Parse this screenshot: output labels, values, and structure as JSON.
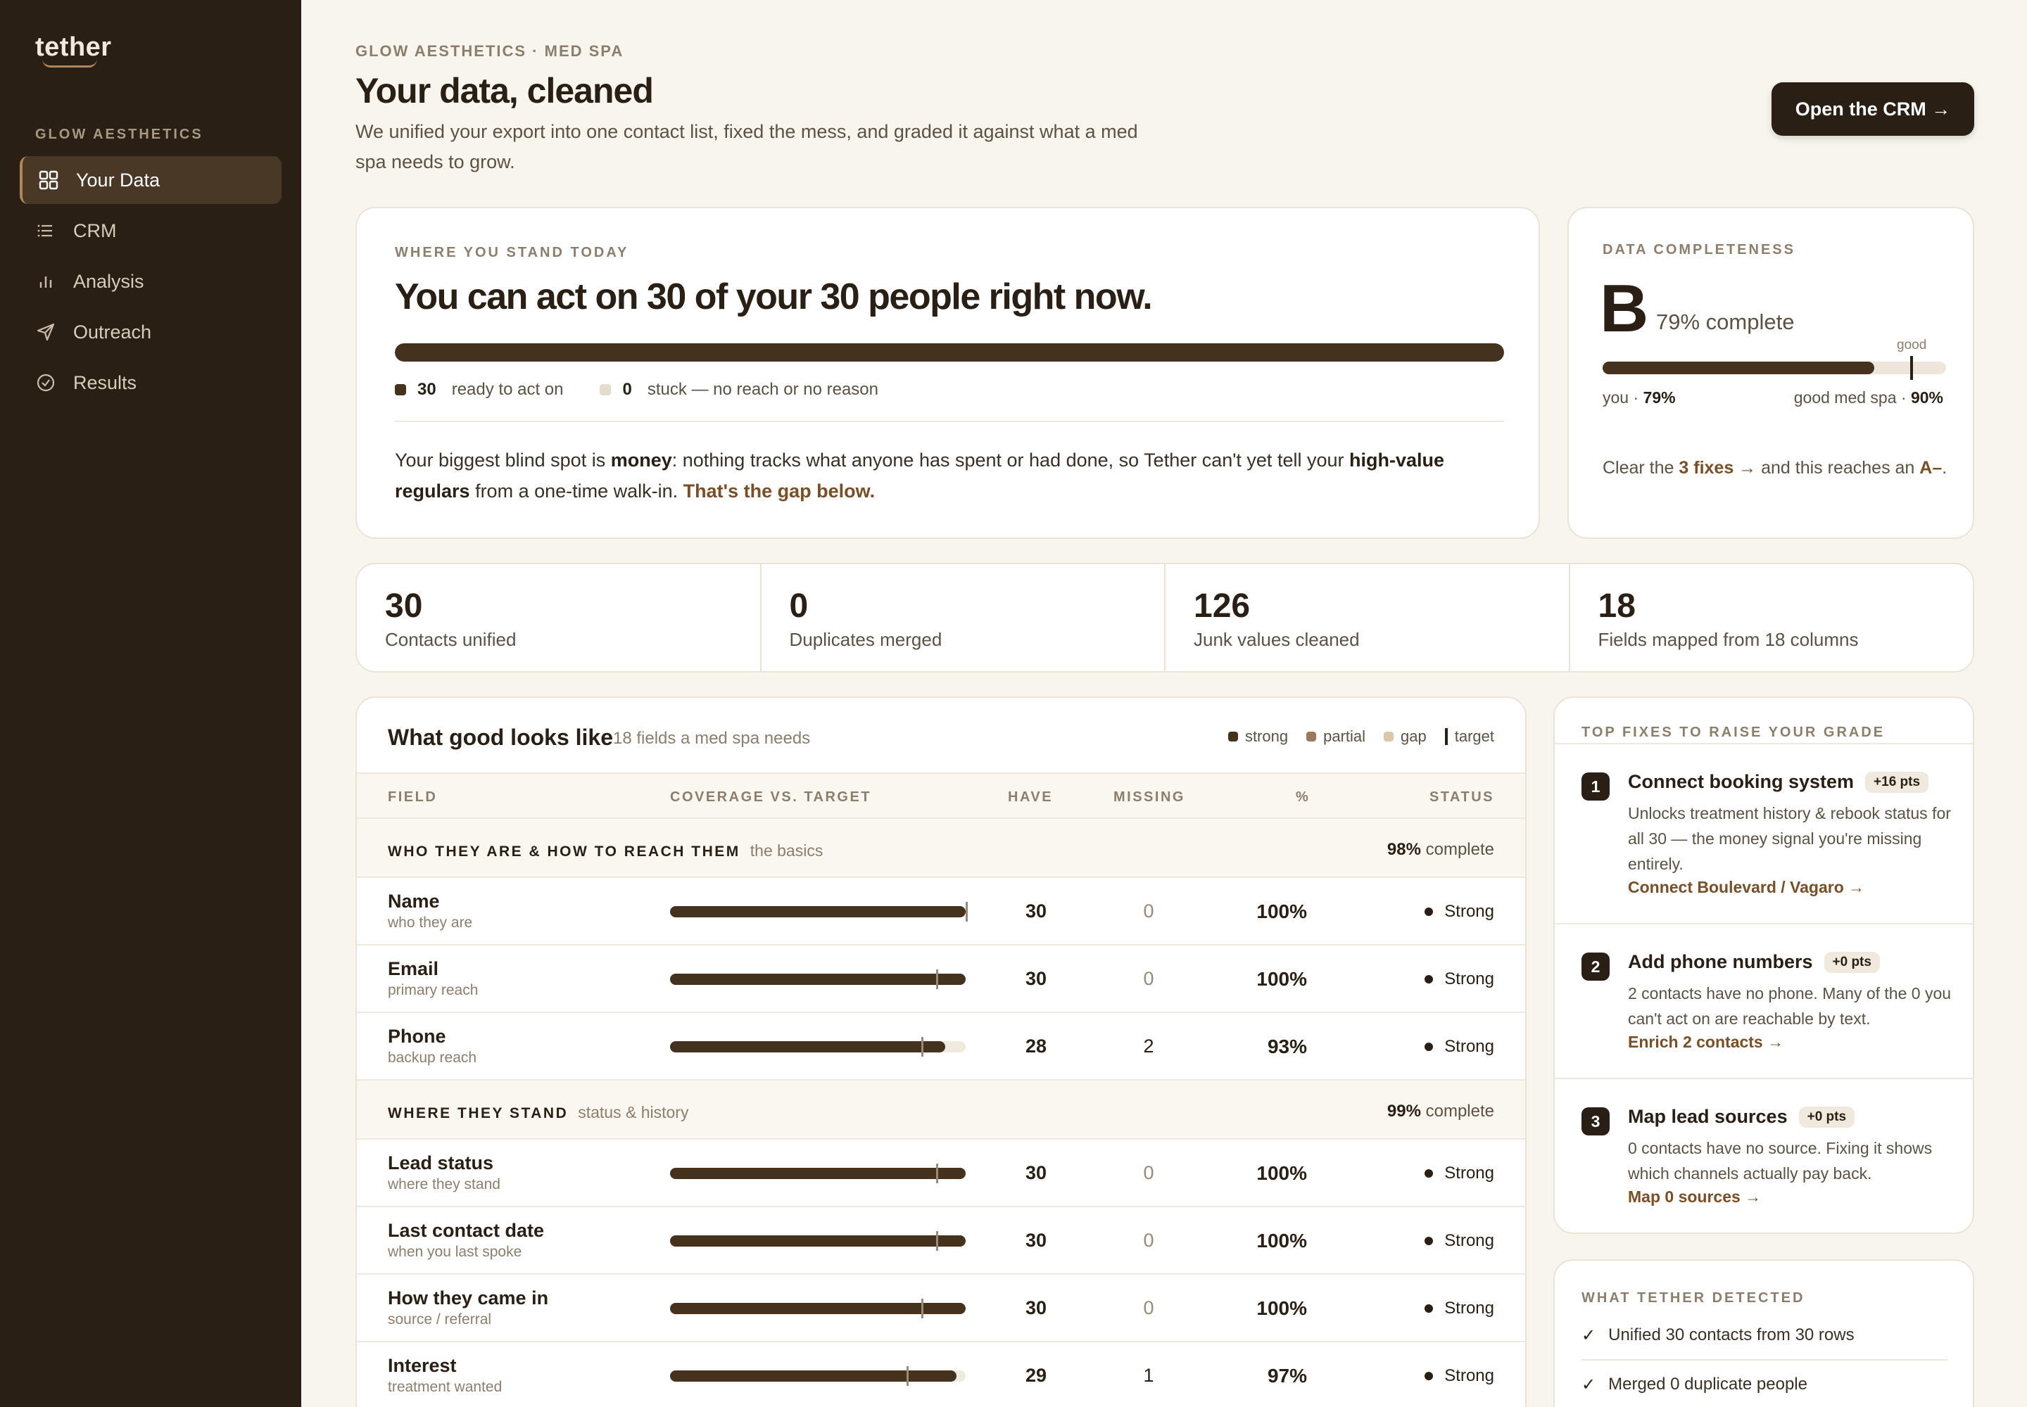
{
  "sidebar": {
    "logo": "tether",
    "org": "GLOW AESTHETICS",
    "items": [
      {
        "label": "Your Data",
        "icon": "grid-icon"
      },
      {
        "label": "CRM",
        "icon": "list-icon"
      },
      {
        "label": "Analysis",
        "icon": "bar-chart-icon"
      },
      {
        "label": "Outreach",
        "icon": "send-icon"
      },
      {
        "label": "Results",
        "icon": "check-circle-icon"
      }
    ]
  },
  "header": {
    "crumb": "GLOW AESTHETICS · MED SPA",
    "title": "Your data, cleaned",
    "subtitle": "We unified your export into one contact list, fixed the mess, and graded it against what a med spa needs to grow.",
    "crm_button": "Open the CRM →"
  },
  "stand": {
    "eyebrow": "WHERE YOU STAND TODAY",
    "title": "You can act on 30 of your 30 people right now.",
    "ready_fraction": 1.0,
    "ready_count": "30",
    "ready_label": "ready to act on",
    "stuck_count": "0",
    "stuck_label": "stuck — no reach or no reason",
    "text_1": "Your biggest blind spot is ",
    "text_money": "money",
    "text_2": ": nothing tracks what anyone has spent or had done, so Tether can't yet tell your ",
    "text_hv": "high-value regulars",
    "text_3": " from a one-time walk-in. ",
    "text_link": "That's the gap below."
  },
  "completeness": {
    "eyebrow": "DATA COMPLETENESS",
    "grade": "B",
    "pct_text": "79% complete",
    "good_label": "good",
    "you_value": 0.79,
    "good_value": 0.9,
    "you_label": "you · ",
    "you_pct": "79%",
    "good_med_label": "good med spa · ",
    "good_pct": "90%",
    "text_1": "Clear the ",
    "text_link": "3 fixes →",
    "text_2": " and this reaches an ",
    "text_grade": "A–",
    "text_3": "."
  },
  "stats": [
    {
      "num": "30",
      "label": "Contacts unified"
    },
    {
      "num": "0",
      "label": "Duplicates merged"
    },
    {
      "num": "126",
      "label": "Junk values cleaned"
    },
    {
      "num": "18",
      "label": "Fields mapped from 18 columns"
    }
  ],
  "table": {
    "title": "What good looks like",
    "subtitle": "18 fields a med spa needs",
    "legend": {
      "strong": "strong",
      "partial": "partial",
      "gap": "gap",
      "target": "target"
    },
    "legend_colors": {
      "strong": "#44321f",
      "partial": "#9a7a5a",
      "gap": "#dcc7a8"
    },
    "columns": {
      "field": "FIELD",
      "coverage": "COVERAGE VS. TARGET",
      "have": "HAVE",
      "missing": "MISSING",
      "pct": "%",
      "status": "STATUS"
    },
    "sections": [
      {
        "name": "WHO THEY ARE & HOW TO REACH THEM",
        "hint": "the basics",
        "pct": "98%",
        "pct_label": " complete"
      },
      {
        "name": "WHERE THEY STAND",
        "hint": "status & history",
        "pct": "99%",
        "pct_label": " complete"
      }
    ],
    "rows": [
      {
        "name": "Name",
        "desc": "who they are",
        "coverage": 1.0,
        "target": 1.0,
        "have": "30",
        "missing": "0",
        "pct": "100%",
        "status": "Strong"
      },
      {
        "name": "Email",
        "desc": "primary reach",
        "coverage": 1.0,
        "target": 0.9,
        "have": "30",
        "missing": "0",
        "pct": "100%",
        "status": "Strong"
      },
      {
        "name": "Phone",
        "desc": "backup reach",
        "coverage": 0.93,
        "target": 0.85,
        "have": "28",
        "missing": "2",
        "pct": "93%",
        "status": "Strong"
      },
      {
        "name": "Lead status",
        "desc": "where they stand",
        "coverage": 1.0,
        "target": 0.9,
        "have": "30",
        "missing": "0",
        "pct": "100%",
        "status": "Strong"
      },
      {
        "name": "Last contact date",
        "desc": "when you last spoke",
        "coverage": 1.0,
        "target": 0.9,
        "have": "30",
        "missing": "0",
        "pct": "100%",
        "status": "Strong"
      },
      {
        "name": "How they came in",
        "desc": "source / referral",
        "coverage": 1.0,
        "target": 0.85,
        "have": "30",
        "missing": "0",
        "pct": "100%",
        "status": "Strong"
      },
      {
        "name": "Interest",
        "desc": "treatment wanted",
        "coverage": 0.97,
        "target": 0.8,
        "have": "29",
        "missing": "1",
        "pct": "97%",
        "status": "Strong"
      }
    ]
  },
  "fixes": {
    "eyebrow": "TOP FIXES TO RAISE YOUR GRADE",
    "items": [
      {
        "num": "1",
        "title": "Connect booking system",
        "pts": "+16 pts",
        "desc": "Unlocks treatment history & rebook status for all 30 — the money signal you're missing entirely.",
        "link": "Connect Boulevard / Vagaro →"
      },
      {
        "num": "2",
        "title": "Add phone numbers",
        "pts": "+0 pts",
        "desc": "2 contacts have no phone. Many of the 0 you can't act on are reachable by text.",
        "link": "Enrich 2 contacts →"
      },
      {
        "num": "3",
        "title": "Map lead sources",
        "pts": "+0 pts",
        "desc": "0 contacts have no source. Fixing it shows which channels actually pay back.",
        "link": "Map 0 sources →"
      }
    ]
  },
  "detected": {
    "eyebrow": "WHAT TETHER DETECTED",
    "items": [
      "Unified 30 contacts from 30 rows",
      "Merged 0 duplicate people"
    ]
  }
}
